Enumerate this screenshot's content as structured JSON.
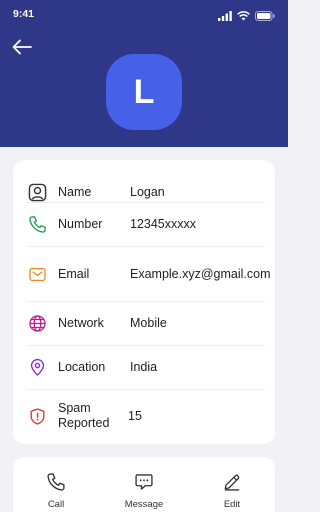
{
  "status_bar": {
    "time": "9:41"
  },
  "contact": {
    "initial": "L",
    "fields": [
      {
        "icon": "person-icon",
        "label": "Name",
        "value": "Logan"
      },
      {
        "icon": "phone-icon",
        "label": "Number",
        "value": "12345xxxxx"
      },
      {
        "icon": "email-icon",
        "label": "Email",
        "value": "Example.xyz@gmail.com"
      },
      {
        "icon": "globe-icon",
        "label": "Network",
        "value": "Mobile"
      },
      {
        "icon": "location-pin-icon",
        "label": "Location",
        "value": "India"
      },
      {
        "icon": "shield-alert-icon",
        "label": "Spam Reported",
        "value": "15"
      }
    ]
  },
  "actions": [
    {
      "icon": "phone-icon",
      "label": "Call"
    },
    {
      "icon": "message-icon",
      "label": "Message"
    },
    {
      "icon": "pencil-icon",
      "label": "Edit"
    }
  ],
  "colors": {
    "header": "#2e3788",
    "avatar": "#4760e8",
    "name_icon": "#333333",
    "number_icon": "#1f9d4c",
    "email_icon": "#f08a24",
    "network_icon": "#c2188f",
    "location_icon": "#8e2ad1",
    "spam_icon": "#e03131"
  }
}
